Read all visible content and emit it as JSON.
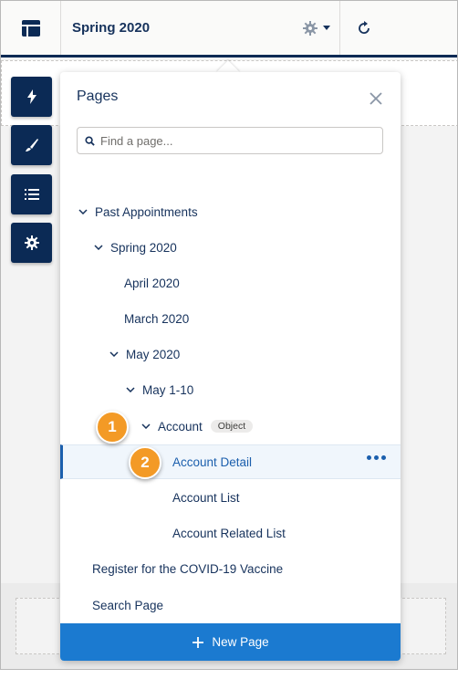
{
  "header": {
    "title": "Spring 2020",
    "menu_icon": "layout-icon",
    "settings_icon": "gear-icon",
    "dropdown_icon": "caret-down-icon",
    "refresh_icon": "refresh-icon"
  },
  "toolbar": {
    "tools": [
      {
        "name": "lightning-icon"
      },
      {
        "name": "brush-icon"
      },
      {
        "name": "list-icon"
      },
      {
        "name": "gear-icon"
      }
    ]
  },
  "pages_panel": {
    "title": "Pages",
    "search_placeholder": "Find a page...",
    "tree": [
      {
        "label": "Past Appointments",
        "expanded": true
      },
      {
        "label": "Spring 2020",
        "expanded": true
      },
      {
        "label": "April 2020"
      },
      {
        "label": "March 2020"
      },
      {
        "label": "May 2020",
        "expanded": true
      },
      {
        "label": "May 1-10",
        "expanded": true
      },
      {
        "label": "Account",
        "expanded": true,
        "badge": "Object"
      },
      {
        "label": "Account Detail",
        "selected": true
      },
      {
        "label": "Account List"
      },
      {
        "label": "Account Related List"
      },
      {
        "label": "Register for the COVID-19 Vaccine"
      },
      {
        "label": "Search Page"
      }
    ],
    "new_page_label": "New Page"
  },
  "callouts": [
    "1",
    "2"
  ],
  "colors": {
    "navy": "#0b2a55",
    "accent_blue": "#1b7ad0",
    "selected_text": "#1b5fad",
    "callout_orange": "#f39a26"
  }
}
